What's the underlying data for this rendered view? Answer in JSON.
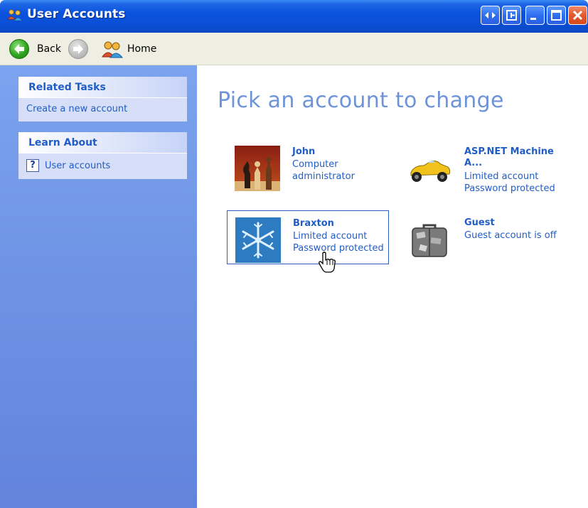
{
  "window": {
    "title": "User Accounts",
    "icon": "user-accounts-icon",
    "titlebar_buttons": [
      "switch-icon",
      "restore-folder-icon",
      "minimize-icon",
      "maximize-icon",
      "close-icon"
    ]
  },
  "toolbar": {
    "back_label": "Back",
    "forward_icon": "forward-arrow-icon",
    "home_label": "Home"
  },
  "sidebar": {
    "related_tasks": {
      "title": "Related Tasks",
      "items": [
        {
          "label": "Create a new account"
        }
      ]
    },
    "learn_about": {
      "title": "Learn About",
      "items": [
        {
          "label": "User accounts",
          "icon": "help-icon"
        }
      ]
    }
  },
  "main": {
    "heading": "Pick an account to change",
    "accounts": [
      {
        "name": "John",
        "lines": [
          "Computer",
          "administrator"
        ],
        "picture": "chess-pieces"
      },
      {
        "name": "ASP.NET Machine",
        "name2": "A...",
        "lines": [
          "Limited account",
          "Password protected"
        ],
        "picture": "race-car"
      },
      {
        "name": "Braxton",
        "lines": [
          "Limited account",
          "Password protected"
        ],
        "picture": "snowflake",
        "selected": true
      },
      {
        "name": "Guest",
        "lines": [
          "Guest account is off"
        ],
        "picture": "suitcase"
      }
    ]
  },
  "colors": {
    "titlebar": "#0a52dd",
    "link": "#215dc6",
    "heading": "#6d93d9",
    "sidebar": "#6f94e5",
    "panel": "#d6dff7"
  }
}
